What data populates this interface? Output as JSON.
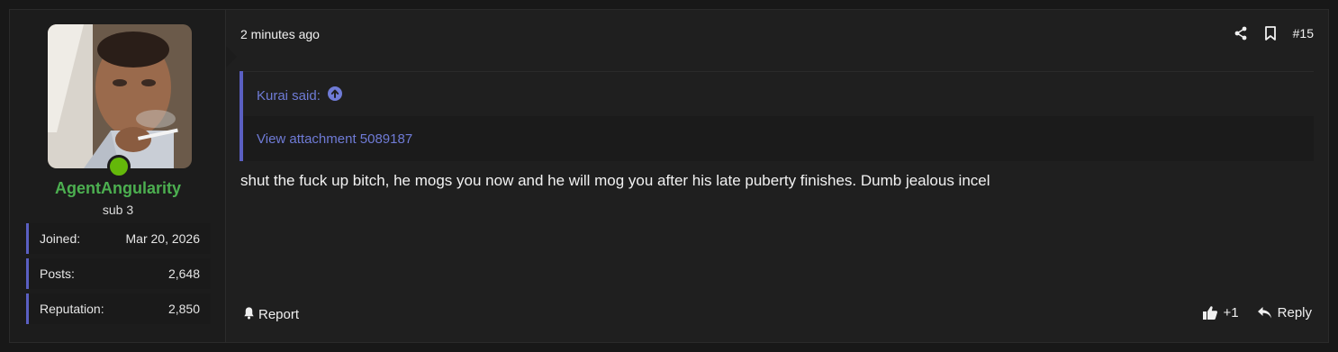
{
  "post": {
    "number": "#15",
    "timestamp": "2 minutes ago",
    "message": "shut the fuck up bitch, he mogs you now and he will mog you after his late puberty finishes. Dumb jealous incel"
  },
  "user": {
    "name": "AgentAngularity",
    "title": "sub 3",
    "name_color": "#4caf50",
    "online_color": "#64b80a",
    "stats": {
      "joined_label": "Joined:",
      "joined_value": "Mar 20, 2026",
      "posts_label": "Posts:",
      "posts_value": "2,648",
      "reputation_label": "Reputation:",
      "reputation_value": "2,850"
    }
  },
  "quote": {
    "author_label": "Kurai said:",
    "body": "View attachment 5089187",
    "accent_color": "#5a5fc2"
  },
  "actions": {
    "report_label": "Report",
    "reaction_count": "+1",
    "reply_label": "Reply",
    "icons": [
      "share-icon",
      "bookmark-icon",
      "bell-icon",
      "thumbs-up-icon",
      "reply-arrow-icon",
      "arrow-up-circle-icon"
    ]
  }
}
